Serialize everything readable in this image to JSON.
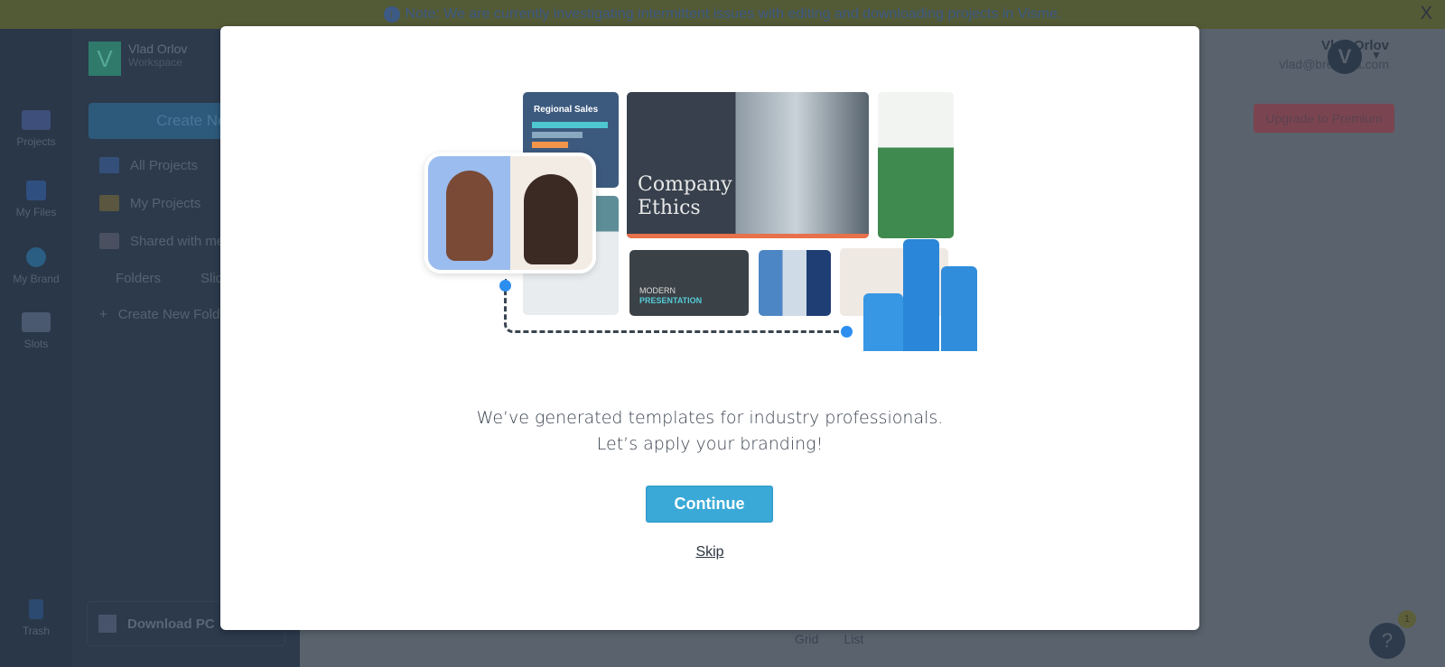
{
  "banner": {
    "text": "Note: We are currently investigating intermittent issues with editing and downloading projects in Visme.",
    "close": "X"
  },
  "rail": [
    {
      "label": "Projects"
    },
    {
      "label": "My Files"
    },
    {
      "label": "My Brand"
    },
    {
      "label": "Slots"
    },
    {
      "label": "Trash"
    }
  ],
  "account": {
    "name": "Vlad Orlov",
    "workspace": "Workspace",
    "logo": "V"
  },
  "sidebar": {
    "create": "Create New",
    "items": [
      {
        "label": "All Projects"
      },
      {
        "label": "My Projects"
      },
      {
        "label": "Shared with me"
      }
    ],
    "tabs": [
      "Folders",
      "Slides"
    ],
    "new_folder": "Create New Folder",
    "download": "Download PC"
  },
  "user": {
    "name": "Vlad Orlov",
    "email": "vlad@bregatta.com",
    "initial": "V"
  },
  "upgrade": "Upgrade to Premium",
  "views": [
    "Grid",
    "List"
  ],
  "help": {
    "label": "?",
    "count": "1"
  },
  "hero": {
    "regional": "Regional Sales",
    "ethics": "Company Ethics",
    "modern": "MODERN",
    "presentation": "PRESENTATION"
  },
  "modal": {
    "line1": "We’ve generated templates for industry professionals.",
    "line2": "Let’s apply your branding!",
    "continue": "Continue",
    "skip": "Skip"
  }
}
